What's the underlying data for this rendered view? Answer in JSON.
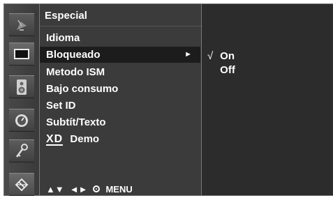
{
  "menu": {
    "title": "Especial",
    "items": [
      {
        "label": "Idioma"
      },
      {
        "label": "Bloqueado",
        "selected": true,
        "arrow": "►"
      },
      {
        "label": "Metodo ISM"
      },
      {
        "label": "Bajo consumo"
      },
      {
        "label": "Set ID"
      },
      {
        "label": "Subtít/Texto"
      },
      {
        "logo": "XD",
        "label": "Demo"
      }
    ],
    "footer": {
      "nav_up_down": "▲▼",
      "nav_left_right": "◄►",
      "menu_label": "MENU"
    }
  },
  "submenu": {
    "check_mark": "√",
    "options": [
      {
        "label": "On",
        "checked": true
      },
      {
        "label": "Off",
        "checked": false
      }
    ]
  },
  "rail": {
    "icons": [
      "satellite-dish-icon",
      "picture-icon",
      "speaker-icon",
      "clock-icon",
      "key-lock-icon",
      "special-tools-icon"
    ]
  },
  "colors": {
    "background": "#2f2f2f",
    "selected_row": "#1c1c1c",
    "text": "#ffffff"
  }
}
